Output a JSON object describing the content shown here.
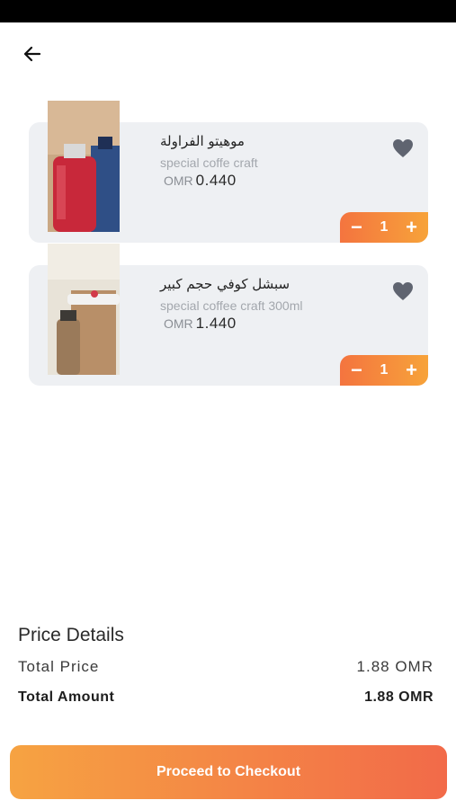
{
  "header": {
    "back_icon": "arrow-left-icon"
  },
  "cart": {
    "items": [
      {
        "name": "موهيتو الفراولة",
        "subtitle": "special coffe craft",
        "currency": "OMR",
        "price": "0.440",
        "quantity": "1",
        "minus": "−",
        "plus": "+",
        "favorite_icon": "heart-icon"
      },
      {
        "name": "سبشل كوفي حجم كبير",
        "subtitle": "special coffee craft 300ml",
        "currency": "OMR",
        "price": "1.440",
        "quantity": "1",
        "minus": "−",
        "plus": "+",
        "favorite_icon": "heart-icon"
      }
    ]
  },
  "price_details": {
    "heading": "Price Details",
    "total_price_label": "Total Price",
    "total_price_value": "1.88 OMR",
    "total_amount_label": "Total Amount",
    "total_amount_value": "1.88 OMR"
  },
  "checkout": {
    "label": "Proceed to Checkout"
  },
  "colors": {
    "accent_start": "#f4743f",
    "accent_end": "#f7a33a",
    "card_bg": "#eef0f3",
    "heart": "#5f6470"
  }
}
